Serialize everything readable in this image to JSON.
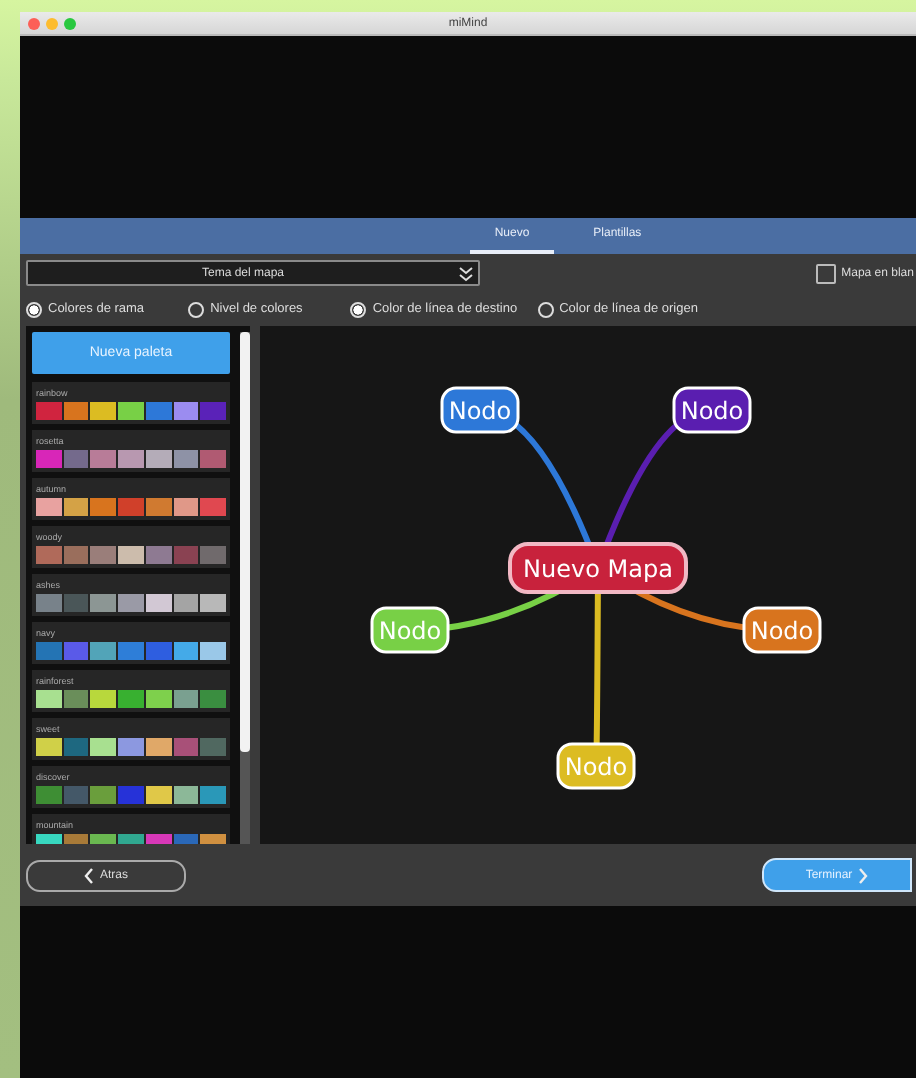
{
  "window": {
    "title": "miMind"
  },
  "tabs": [
    {
      "label": "Nuevo",
      "selected": true
    },
    {
      "label": "Plantillas",
      "selected": false
    }
  ],
  "theme_dropdown": {
    "value": "Tema del mapa"
  },
  "blank_map": {
    "label": "Mapa en blan",
    "checked": false
  },
  "branch_color_options": [
    {
      "label": "Colores de rama",
      "selected": true
    },
    {
      "label": "Nivel de colores",
      "selected": false
    }
  ],
  "line_color_options": [
    {
      "label": "Color de línea de destino",
      "selected": true
    },
    {
      "label": "Color de línea de origen",
      "selected": false
    }
  ],
  "new_palette_button": "Nueva paleta",
  "palettes": [
    {
      "name": "rainbow",
      "swatches": [
        {
          "color": "#d0243f"
        },
        {
          "color": "#d8741e"
        },
        {
          "color": "#dcbc22"
        },
        {
          "color": "#78d046"
        },
        {
          "color": "#2d78d8"
        },
        {
          "color": "#9b8cf0"
        },
        {
          "color": "#5a22b8"
        }
      ]
    },
    {
      "name": "rosetta",
      "swatches": [
        {
          "color": "#d826b8"
        },
        {
          "color": "#746a8c"
        },
        {
          "color": "#b87c98"
        },
        {
          "color": "#b898b0"
        },
        {
          "color": "#b4acb8"
        },
        {
          "color": "#8e92a6"
        },
        {
          "color": "#b05a72"
        }
      ]
    },
    {
      "name": "autumn",
      "swatches": [
        {
          "color": "#e8a2a0"
        },
        {
          "color": "#d4a246"
        },
        {
          "color": "#d8741e"
        },
        {
          "color": "#d0402a"
        },
        {
          "color": "#d07a30"
        },
        {
          "color": "#e09888"
        },
        {
          "color": "#e04850"
        }
      ]
    },
    {
      "name": "woody",
      "swatches": [
        {
          "color": "#b06a5a"
        },
        {
          "color": "#9a6e5c"
        },
        {
          "color": "#9a7e7a"
        },
        {
          "color": "#ccbcac"
        },
        {
          "color": "#8e7a92"
        },
        {
          "color": "#8a4252"
        },
        {
          "color": "#706a6c"
        }
      ]
    },
    {
      "name": "ashes",
      "swatches": [
        {
          "color": "#78828a"
        },
        {
          "color": "#4a5658"
        },
        {
          "color": "#8c9694"
        },
        {
          "color": "#9a9aa6"
        },
        {
          "color": "#d2c8d4"
        },
        {
          "color": "#a4a4a4"
        },
        {
          "color": "#b8b8b8"
        }
      ]
    },
    {
      "name": "navy",
      "swatches": [
        {
          "color": "#2474b4"
        },
        {
          "color": "#5a5ae8"
        },
        {
          "color": "#52a4b8"
        },
        {
          "color": "#2e7ed8"
        },
        {
          "color": "#2e5ee0"
        },
        {
          "color": "#44aae8"
        },
        {
          "color": "#9ac8e8"
        }
      ]
    },
    {
      "name": "rainforest",
      "swatches": [
        {
          "color": "#a8e090"
        },
        {
          "color": "#6a8e5a"
        },
        {
          "color": "#b8d83c"
        },
        {
          "color": "#38b030"
        },
        {
          "color": "#7ed04c"
        },
        {
          "color": "#7aa090"
        },
        {
          "color": "#3a8e40"
        }
      ]
    },
    {
      "name": "sweet",
      "swatches": [
        {
          "color": "#d0d048"
        },
        {
          "color": "#1e6880"
        },
        {
          "color": "#a8e090"
        },
        {
          "color": "#8c98e0"
        },
        {
          "color": "#e0a868"
        },
        {
          "color": "#a85078"
        },
        {
          "color": "#506860"
        }
      ]
    },
    {
      "name": "discover",
      "swatches": [
        {
          "color": "#3e8e34"
        },
        {
          "color": "#445868"
        },
        {
          "color": "#6a9e3c"
        },
        {
          "color": "#2632d8"
        },
        {
          "color": "#e0c848"
        },
        {
          "color": "#8cb898"
        },
        {
          "color": "#2a98b8"
        }
      ]
    },
    {
      "name": "mountain",
      "swatches": [
        {
          "color": "#38d8c0"
        },
        {
          "color": "#a87a38"
        },
        {
          "color": "#6ab850"
        },
        {
          "color": "#30a890"
        },
        {
          "color": "#d838b8"
        },
        {
          "color": "#2a68b8"
        },
        {
          "color": "#d09040"
        }
      ]
    }
  ],
  "mind_map": {
    "center": {
      "label": "Nuevo Mapa",
      "color": "#c8223c"
    },
    "branches": [
      {
        "label": "Nodo",
        "color": "#2d78d8"
      },
      {
        "label": "Nodo",
        "color": "#5a1eb0"
      },
      {
        "label": "Nodo",
        "color": "#78d046"
      },
      {
        "label": "Nodo",
        "color": "#d8741e"
      },
      {
        "label": "Nodo",
        "color": "#dcbc22"
      }
    ]
  },
  "back_button": "Atras",
  "finish_button": "Terminar"
}
